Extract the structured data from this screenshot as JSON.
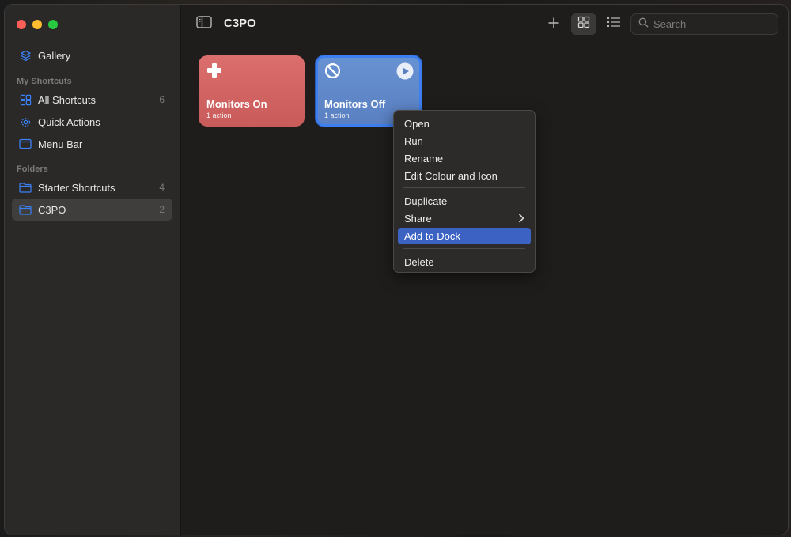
{
  "window": {
    "title": "C3PO"
  },
  "sidebar": {
    "gallery": {
      "label": "Gallery",
      "icon": "gallery-icon"
    },
    "my_shortcuts_label": "My Shortcuts",
    "items": [
      {
        "label": "All Shortcuts",
        "count": "6",
        "icon": "grid-icon"
      },
      {
        "label": "Quick Actions",
        "count": "",
        "icon": "gear-icon"
      },
      {
        "label": "Menu Bar",
        "count": "",
        "icon": "menubar-icon"
      }
    ],
    "folders_label": "Folders",
    "folders": [
      {
        "label": "Starter Shortcuts",
        "count": "4",
        "icon": "folder-icon"
      },
      {
        "label": "C3PO",
        "count": "2",
        "icon": "folder-icon",
        "selected": true
      }
    ]
  },
  "toolbar": {
    "search_placeholder": "Search",
    "view_mode": "grid"
  },
  "shortcuts": [
    {
      "name": "Monitors On",
      "subtitle": "1 action",
      "color": "#d4605f",
      "icon": "plus-icon"
    },
    {
      "name": "Monitors Off",
      "subtitle": "1 action",
      "color": "#5f88c8",
      "icon": "prohibited-icon",
      "selected": true
    }
  ],
  "context_menu": {
    "items": [
      "Open",
      "Run",
      "Rename",
      "Edit Colour and Icon",
      "Duplicate",
      "Share",
      "Add to Dock",
      "Delete"
    ],
    "highlighted": "Add to Dock"
  },
  "colors": {
    "accent": "#3c63c3",
    "sidebar_icon": "#3b82f6"
  }
}
